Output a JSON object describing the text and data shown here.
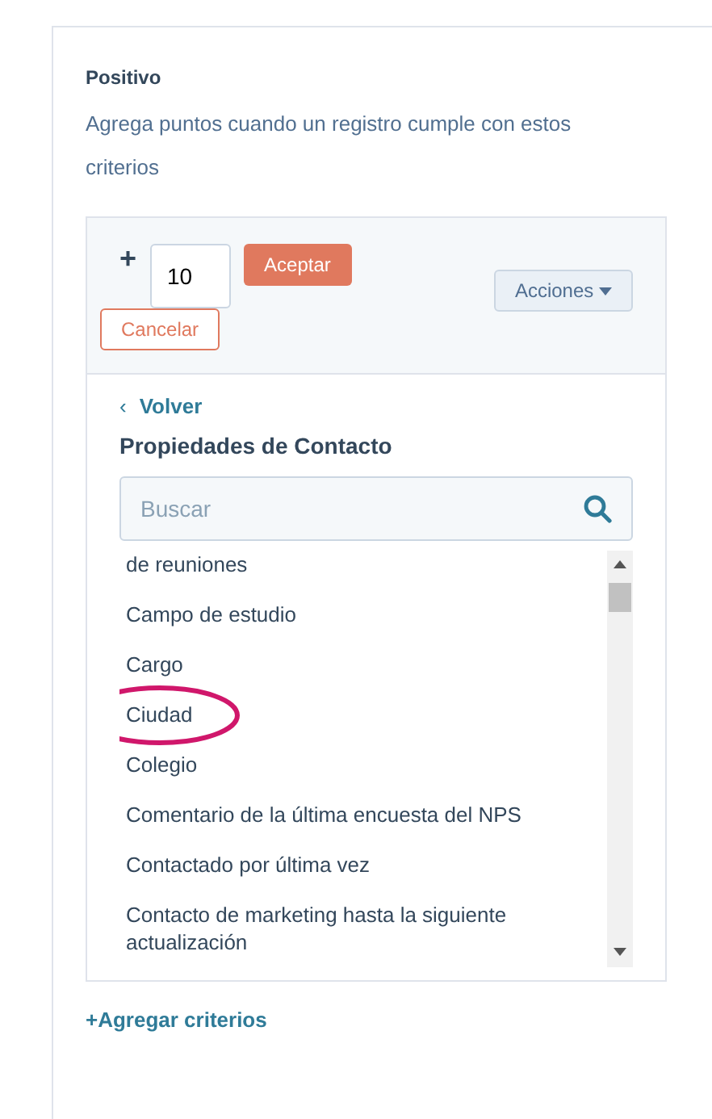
{
  "section": {
    "title": "Positivo",
    "description": "Agrega puntos cuando un registro cumple con estos criterios"
  },
  "editor": {
    "operator": "+",
    "points": "10",
    "accept_button": "Aceptar",
    "cancel_button": "Cancelar",
    "actions_button": "Acciones"
  },
  "picker": {
    "back_link": "Volver",
    "back_icon": "‹",
    "heading": "Propiedades de Contacto",
    "search": {
      "placeholder": "Buscar"
    },
    "items": [
      {
        "label": "de reuniones",
        "circled": false
      },
      {
        "label": "Campo de estudio",
        "circled": false
      },
      {
        "label": "Cargo",
        "circled": false
      },
      {
        "label": "Ciudad",
        "circled": true
      },
      {
        "label": "Colegio",
        "circled": false
      },
      {
        "label": "Comentario de la última encuesta del NPS",
        "circled": false
      },
      {
        "label": "Contactado por última vez",
        "circled": false
      },
      {
        "label": "Contacto de marketing hasta la siguiente actualización",
        "circled": false
      }
    ]
  },
  "add_link": "+Agregar criterios"
}
